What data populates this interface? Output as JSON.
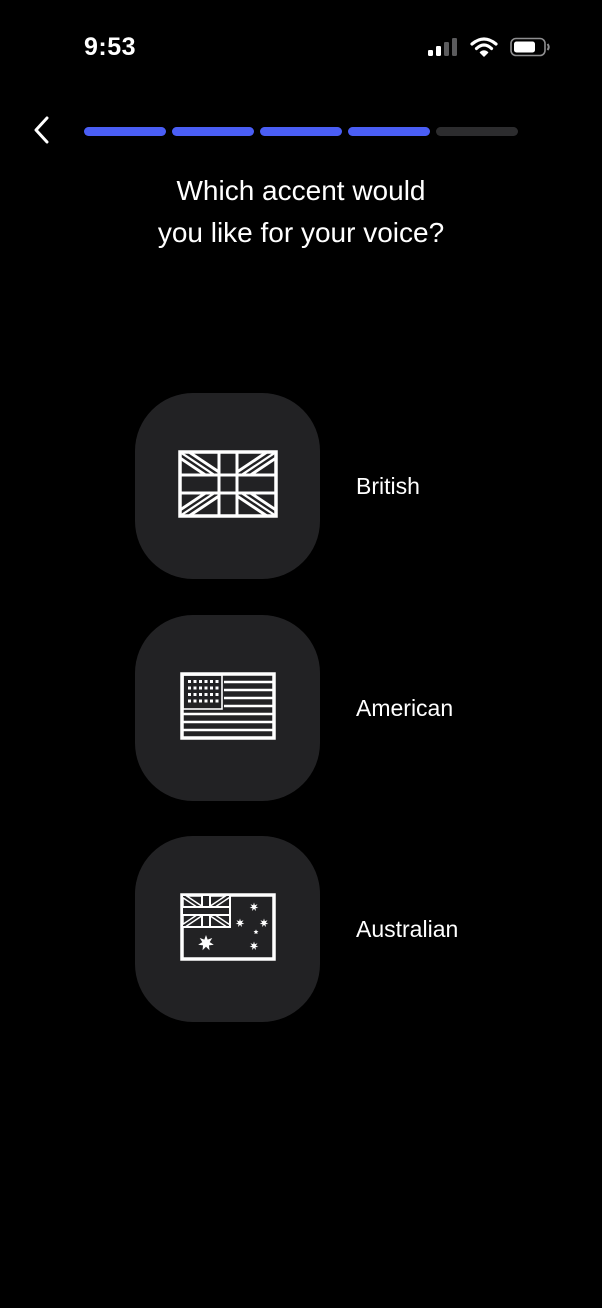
{
  "status_bar": {
    "time": "9:53",
    "icons": [
      "cellular-signal-icon",
      "wifi-icon",
      "battery-icon"
    ]
  },
  "navigation": {
    "back_icon": "chevron-left-icon",
    "progress": {
      "total_steps": 5,
      "completed_steps": 4
    }
  },
  "question": {
    "line1": "Which accent would",
    "line2": "you like for your voice?"
  },
  "options": [
    {
      "label": "British",
      "icon": "uk-flag-icon"
    },
    {
      "label": "American",
      "icon": "us-flag-icon"
    },
    {
      "label": "Australian",
      "icon": "australia-flag-icon"
    }
  ],
  "colors": {
    "background": "#000000",
    "accent": "#4a5ef5",
    "progress_inactive": "#2c2c2e",
    "tile": "#222224",
    "text": "#ffffff"
  }
}
